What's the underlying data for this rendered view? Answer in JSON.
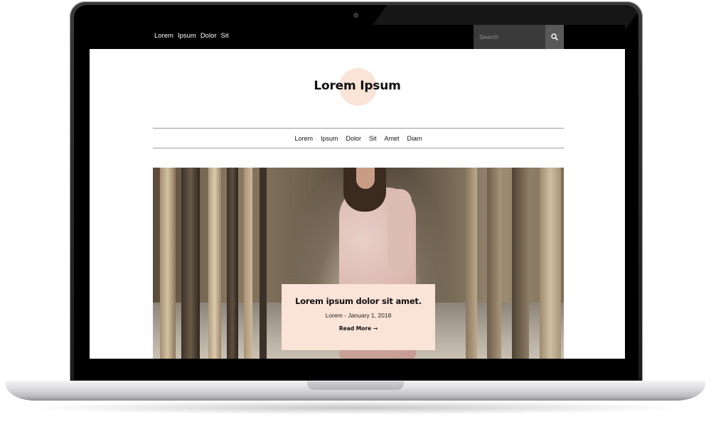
{
  "top_bar": {
    "links": [
      "Lorem",
      "Ipsum",
      "Dolor",
      "Sit"
    ],
    "search": {
      "placeholder": "Search",
      "icon": "search-icon"
    },
    "background": "#000000"
  },
  "site": {
    "logo_text": "Lorem Ipsum",
    "logo_accent": "#fae3d7"
  },
  "nav": {
    "items": [
      "Lorem",
      "Ipsum",
      "Dolor",
      "Sit",
      "Amet",
      "Diam"
    ]
  },
  "featured_post": {
    "title": "Lorem ipsum dolor sit amet.",
    "meta": "Lorem - January 1, 2018",
    "read_more": "Read More →",
    "card_color": "#fae3d7"
  }
}
